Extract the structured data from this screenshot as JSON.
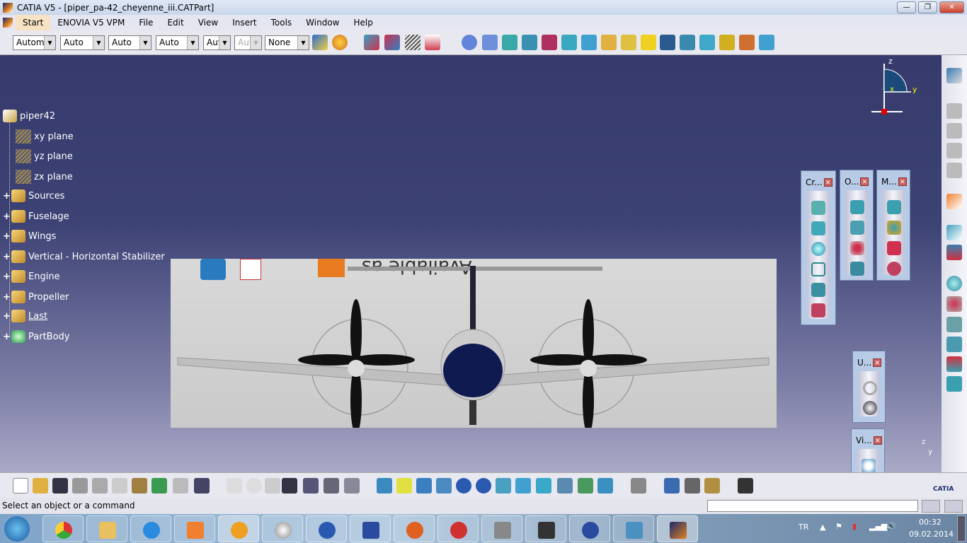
{
  "window": {
    "title": "CATIA V5 - [piper_pa-42_cheyenne_iii.CATPart]",
    "buttons": [
      "minimize",
      "restore",
      "close"
    ]
  },
  "menu": [
    "Start",
    "ENOVIA V5 VPM",
    "File",
    "Edit",
    "View",
    "Insert",
    "Tools",
    "Window",
    "Help"
  ],
  "toolbar": {
    "combos": [
      {
        "value": "Automa",
        "disabled": false
      },
      {
        "value": "Auto",
        "disabled": false
      },
      {
        "value": "Auto",
        "disabled": false
      },
      {
        "value": "Auto",
        "disabled": false
      },
      {
        "value": "Aut",
        "disabled": false
      },
      {
        "value": "Aut",
        "disabled": true
      },
      {
        "value": "None",
        "disabled": false
      }
    ]
  },
  "tree": {
    "root": "piper42",
    "items": [
      {
        "label": "xy plane",
        "type": "plane"
      },
      {
        "label": "yz plane",
        "type": "plane"
      },
      {
        "label": "zx plane",
        "type": "plane"
      },
      {
        "label": "Sources",
        "type": "set"
      },
      {
        "label": "Fuselage",
        "type": "set"
      },
      {
        "label": "Wings",
        "type": "set"
      },
      {
        "label": "Vertical - Horizontal Stabilizer",
        "type": "set"
      },
      {
        "label": "Engine",
        "type": "set"
      },
      {
        "label": "Propeller",
        "type": "set"
      },
      {
        "label": "Last",
        "type": "set"
      },
      {
        "label": "PartBody",
        "type": "body"
      }
    ]
  },
  "picture": {
    "mirrored_text": "Available as"
  },
  "compass": {
    "axes": [
      "z",
      "x",
      "y"
    ]
  },
  "panels": [
    {
      "title": "Cr..."
    },
    {
      "title": "O..."
    },
    {
      "title": "M..."
    },
    {
      "title": "U..."
    },
    {
      "title": "Vi..."
    }
  ],
  "axis_small": {
    "z": "z",
    "y": "y"
  },
  "brand": "CATIA",
  "status": {
    "message": "Select an object or a command",
    "input": ""
  },
  "tray": {
    "lang": "TR",
    "time": "00:32",
    "date": "09.02.2014"
  },
  "colors": {
    "viewport_top": "#363a6c",
    "viewport_bottom": "#a9a9c6"
  }
}
